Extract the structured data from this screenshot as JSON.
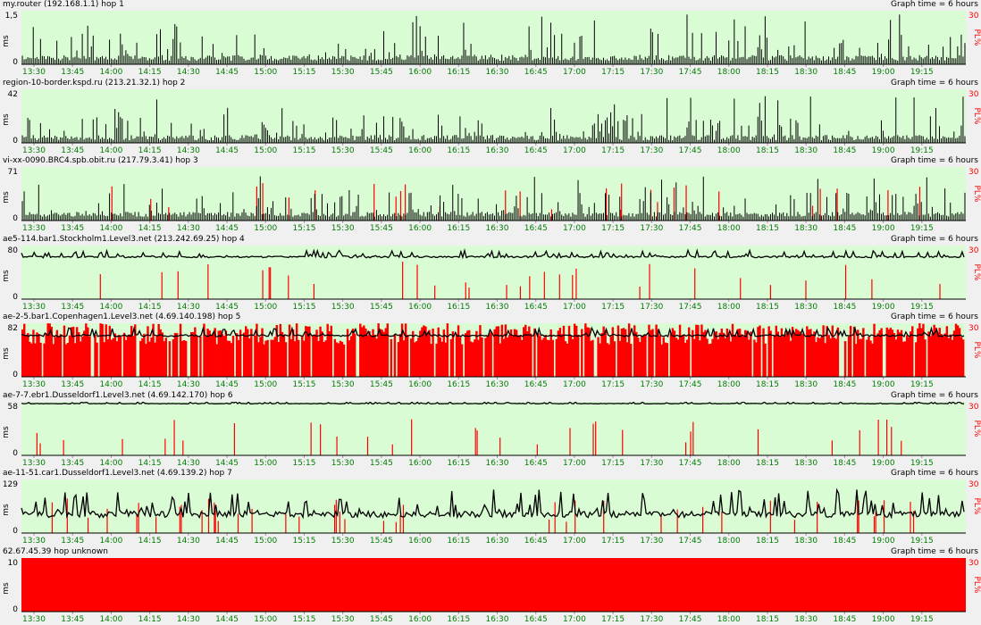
{
  "colors": {
    "plot_bg": "#d9fcd4",
    "latency": "#000000",
    "loss": "#ff0000",
    "grid": "#9a9a9a",
    "tick_text": "#008000"
  },
  "common": {
    "graph_time": "Graph time = 6 hours",
    "ylabel": "ms",
    "pl_label": "PL%",
    "pl_max": "30",
    "x_ticks": [
      "13:30",
      "13:45",
      "14:00",
      "14:15",
      "14:30",
      "14:45",
      "15:00",
      "15:15",
      "15:30",
      "15:45",
      "16:00",
      "16:15",
      "16:30",
      "16:45",
      "17:00",
      "17:15",
      "17:30",
      "17:45",
      "18:00",
      "18:15",
      "18:30",
      "18:45",
      "19:00",
      "19:15"
    ]
  },
  "chart_data": [
    {
      "type": "bar",
      "title": "my.router (192.168.1.1) hop 1",
      "ylim": [
        0,
        1.5
      ],
      "ytick_top": "1,5",
      "ytick_bottom": "0",
      "baseline": 0.1,
      "spike_max": 1.3,
      "loss_mode": "none",
      "loss_count": 0,
      "seed": 11
    },
    {
      "type": "bar",
      "title": "region-10-border.kspd.ru (213.21.32.1) hop 2",
      "ylim": [
        0,
        42
      ],
      "ytick_top": "42",
      "ytick_bottom": "0",
      "baseline": 2,
      "spike_max": 35,
      "loss_mode": "none",
      "loss_count": 0,
      "seed": 23
    },
    {
      "type": "bar",
      "title": "vi-xx-0090.BRC4.spb.obit.ru (217.79.3.41) hop 3",
      "ylim": [
        0,
        71
      ],
      "ytick_top": "71",
      "ytick_bottom": "0",
      "baseline": 5,
      "spike_max": 55,
      "loss_mode": "sparse",
      "loss_count": 28,
      "seed": 37
    },
    {
      "type": "line",
      "title": "ae5-114.bar1.Stockholm1.Level3.net (213.242.69.25) hop 4",
      "ylim": [
        0,
        80
      ],
      "ytick_top": "80",
      "ytick_bottom": "0",
      "baseline": 63,
      "spike_max": 10,
      "loss_mode": "sparse",
      "loss_count": 30,
      "seed": 41
    },
    {
      "type": "line",
      "title": "ae-2-5.bar1.Copenhagen1.Level3.net (4.69.140.198) hop 5",
      "ylim": [
        0,
        82
      ],
      "ytick_top": "82",
      "ytick_bottom": "0",
      "baseline": 63,
      "spike_max": 12,
      "loss_mode": "heavy",
      "loss_count": 0,
      "seed": 53
    },
    {
      "type": "line",
      "title": "ae-7-7.ebr1.Dusseldorf1.Level3.net (4.69.142.170) hop 6",
      "ylim": [
        0,
        58
      ],
      "ytick_top": "58",
      "ytick_bottom": "0",
      "baseline": 56,
      "spike_max": 2,
      "loss_mode": "sparse",
      "loss_count": 32,
      "seed": 67
    },
    {
      "type": "line",
      "title": "ae-11-51.car1.Dusseldorf1.Level3.net (4.69.139.2) hop 7",
      "ylim": [
        0,
        129
      ],
      "ytick_top": "129",
      "ytick_bottom": "0",
      "baseline": 45,
      "spike_max": 60,
      "loss_mode": "sparse",
      "loss_count": 45,
      "seed": 79
    },
    {
      "type": "area",
      "title": "62.67.45.39 hop unknown",
      "ylim": [
        0,
        10
      ],
      "ytick_top": "10",
      "ytick_bottom": "0",
      "baseline": 0,
      "spike_max": 0,
      "loss_mode": "full",
      "loss_count": 0,
      "seed": 97
    }
  ]
}
